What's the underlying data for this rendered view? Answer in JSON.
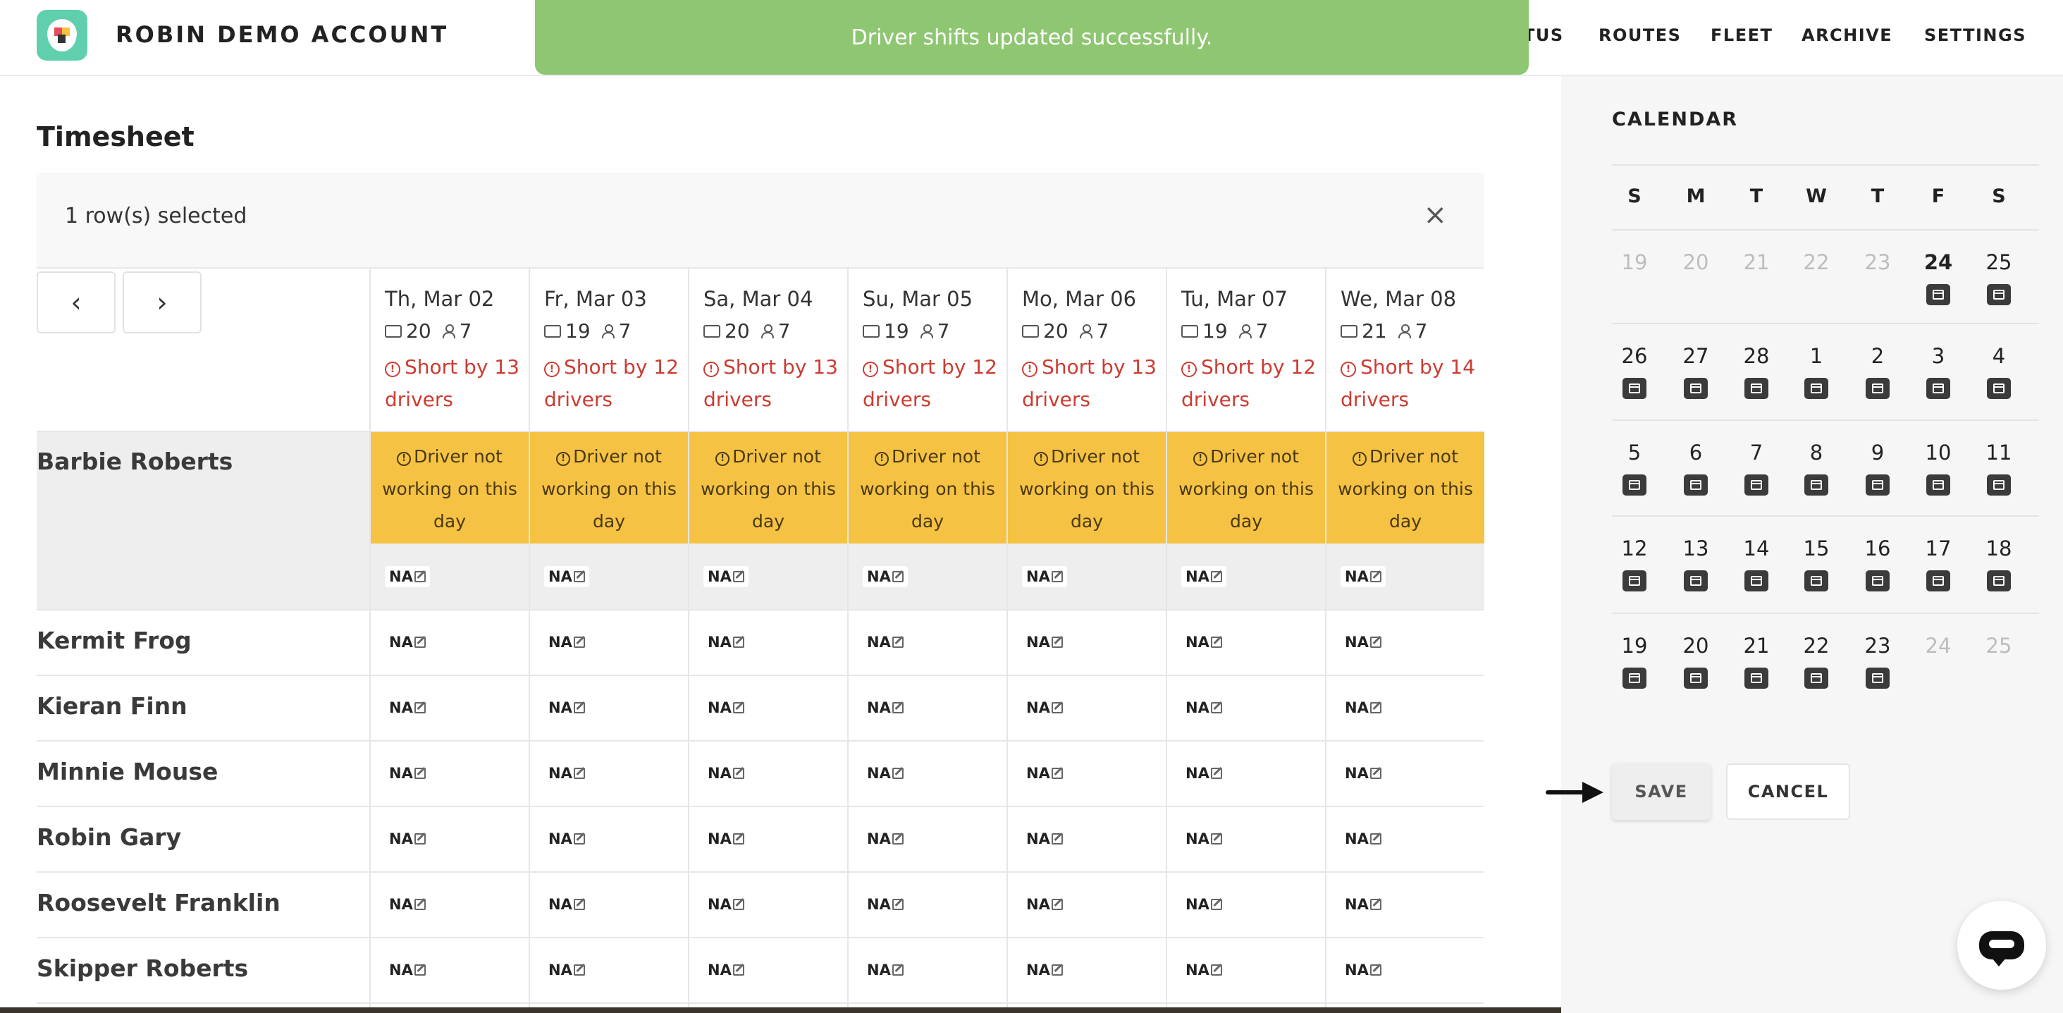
{
  "header": {
    "app_title": "ROBIN DEMO ACCOUNT",
    "nav": [
      "TUS",
      "ROUTES",
      "FLEET",
      "ARCHIVE",
      "SETTINGS"
    ],
    "toast": "Driver shifts updated successfully."
  },
  "main": {
    "title": "Timesheet",
    "selection": "1 row(s) selected",
    "close_glyph": "×",
    "prev_glyph": "‹",
    "next_glyph": "›",
    "days": [
      {
        "label": "Th, Mar 02",
        "vehicles": "20",
        "drivers": "7",
        "short": "Short by 13 drivers"
      },
      {
        "label": "Fr, Mar 03",
        "vehicles": "19",
        "drivers": "7",
        "short": "Short by 12 drivers"
      },
      {
        "label": "Sa, Mar 04",
        "vehicles": "20",
        "drivers": "7",
        "short": "Short by 13 drivers"
      },
      {
        "label": "Su, Mar 05",
        "vehicles": "19",
        "drivers": "7",
        "short": "Short by 12 drivers"
      },
      {
        "label": "Mo, Mar 06",
        "vehicles": "20",
        "drivers": "7",
        "short": "Short by 13 drivers"
      },
      {
        "label": "Tu, Mar 07",
        "vehicles": "19",
        "drivers": "7",
        "short": "Short by 12 drivers"
      },
      {
        "label": "We, Mar 08",
        "vehicles": "21",
        "drivers": "7",
        "short": "Short by 14 drivers"
      }
    ],
    "off_text": "Driver not working on this day",
    "na": "NA",
    "drivers": [
      "Barbie Roberts",
      "Kermit Frog",
      "Kieran Finn",
      "Minnie Mouse",
      "Robin Gary",
      "Roosevelt Franklin",
      "Skipper Roberts"
    ]
  },
  "calendar": {
    "title": "CALENDAR",
    "dow": [
      "S",
      "M",
      "T",
      "W",
      "T",
      "F",
      "S"
    ],
    "weeks": [
      [
        {
          "d": "19",
          "m": true
        },
        {
          "d": "20",
          "m": true
        },
        {
          "d": "21",
          "m": true
        },
        {
          "d": "22",
          "m": true
        },
        {
          "d": "23",
          "m": true
        },
        {
          "d": "24",
          "t": true,
          "i": true
        },
        {
          "d": "25",
          "i": true
        }
      ],
      [
        {
          "d": "26",
          "i": true
        },
        {
          "d": "27",
          "i": true
        },
        {
          "d": "28",
          "i": true
        },
        {
          "d": "1",
          "i": true
        },
        {
          "d": "2",
          "i": true
        },
        {
          "d": "3",
          "i": true
        },
        {
          "d": "4",
          "i": true
        }
      ],
      [
        {
          "d": "5",
          "i": true
        },
        {
          "d": "6",
          "i": true
        },
        {
          "d": "7",
          "i": true
        },
        {
          "d": "8",
          "i": true
        },
        {
          "d": "9",
          "i": true
        },
        {
          "d": "10",
          "i": true
        },
        {
          "d": "11",
          "i": true
        }
      ],
      [
        {
          "d": "12",
          "i": true
        },
        {
          "d": "13",
          "i": true
        },
        {
          "d": "14",
          "i": true
        },
        {
          "d": "15",
          "i": true
        },
        {
          "d": "16",
          "i": true
        },
        {
          "d": "17",
          "i": true
        },
        {
          "d": "18",
          "i": true
        }
      ],
      [
        {
          "d": "19",
          "i": true
        },
        {
          "d": "20",
          "i": true
        },
        {
          "d": "21",
          "i": true
        },
        {
          "d": "22",
          "i": true
        },
        {
          "d": "23",
          "i": true
        },
        {
          "d": "24",
          "m": true
        },
        {
          "d": "25",
          "m": true
        }
      ]
    ],
    "save": "SAVE",
    "cancel": "CANCEL"
  },
  "colors": {
    "toast": "#8ec672",
    "short_text": "#cc3c32",
    "off_cell": "#f5c244",
    "brand": "#5fcfae"
  }
}
